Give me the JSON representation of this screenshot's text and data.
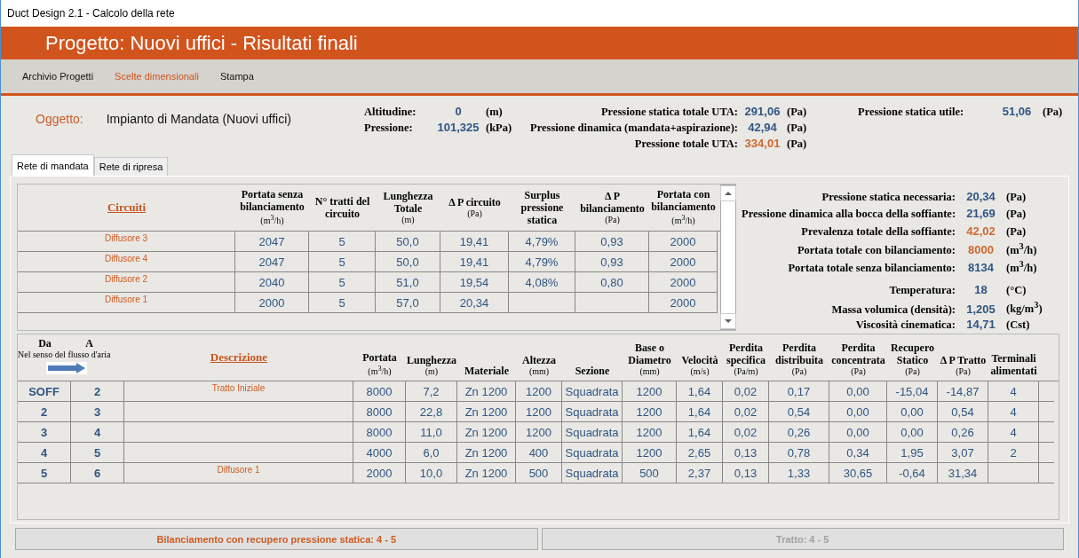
{
  "window": {
    "title": "Duct Design 2.1 - Calcolo della rete"
  },
  "banner": {
    "title": "Progetto: Nuovi uffici - Risultati finali"
  },
  "menu": [
    {
      "label": "Archivio Progetti",
      "selected": false
    },
    {
      "label": "Scelte dimensionali",
      "selected": true
    },
    {
      "label": "Stampa",
      "selected": false
    }
  ],
  "object": {
    "label": "Oggetto:",
    "value": "Impianto di Mandata (Nuovi uffici)"
  },
  "site": [
    {
      "label": "Altitudine:",
      "value": "0",
      "unit": "(m)"
    },
    {
      "label": "Pressione:",
      "value": "101,325",
      "unit": "(kPa)"
    }
  ],
  "uta": [
    {
      "label": "Pressione statica totale UTA:",
      "value": "291,06",
      "unit": "(Pa)",
      "emphasis": false
    },
    {
      "label": "Pressione dinamica (mandata+aspirazione):",
      "value": "42,94",
      "unit": "(Pa)",
      "emphasis": false
    },
    {
      "label": "Pressione totale UTA:",
      "value": "334,01",
      "unit": "(Pa)",
      "emphasis": true
    }
  ],
  "useful": {
    "label": "Pressione statica utile:",
    "value": "51,06",
    "unit": "(Pa)"
  },
  "tabs": [
    {
      "label": "Rete di mandata",
      "selected": true
    },
    {
      "label": "Rete di ripresa",
      "selected": false
    }
  ],
  "circuits": {
    "title": "Circuiti",
    "columns": [
      {
        "label": "Portata senza bilanciamento",
        "unit": "(m$^{3}$/h)"
      },
      {
        "label": "N° tratti del circuito"
      },
      {
        "label": "Lunghezza Totale",
        "unit": "(m)"
      },
      {
        "label": "Δ P circuito",
        "unit": "(Pa)"
      },
      {
        "label": "Surplus pressione statica"
      },
      {
        "label": "Δ P bilanciamento",
        "unit": "(Pa)"
      },
      {
        "label": "Portata con bilanciamento",
        "unit": "(m$^{3}$/h)"
      }
    ],
    "rows": [
      {
        "name": "Diffusore 3",
        "cells": [
          "2047",
          "5",
          "50,0",
          "19,41",
          "4,79%",
          "0,93",
          "2000"
        ]
      },
      {
        "name": "Diffusore 4",
        "cells": [
          "2047",
          "5",
          "50,0",
          "19,41",
          "4,79%",
          "0,93",
          "2000"
        ]
      },
      {
        "name": "Diffusore 2",
        "cells": [
          "2040",
          "5",
          "51,0",
          "19,54",
          "4,08%",
          "0,80",
          "2000"
        ]
      },
      {
        "name": "Diffusore 1",
        "cells": [
          "2000",
          "5",
          "57,0",
          "20,34",
          null,
          null,
          "2000"
        ]
      }
    ]
  },
  "stat_groups": [
    [
      {
        "label": "Pressione statica necessaria:",
        "value": "20,34",
        "unit": "(Pa)",
        "emphasis": false
      },
      {
        "label": "Pressione dinamica alla bocca della soffiante:",
        "value": "21,69",
        "unit": "(Pa)",
        "emphasis": false
      },
      {
        "label": "Prevalenza totale della soffiante:",
        "value": "42,02",
        "unit": "(Pa)",
        "emphasis": true
      },
      {
        "label": "Portata totale con bilanciamento:",
        "value": "8000",
        "unit": "(m$^{3}$/h)",
        "emphasis": true
      },
      {
        "label": "Portata totale senza bilanciamento:",
        "value": "8134",
        "unit": "(m$^{3}$/h)",
        "emphasis": false
      }
    ],
    [
      {
        "label": "Temperatura:",
        "value": "18",
        "unit": "(°C)",
        "emphasis": false
      },
      {
        "label": "Massa volumica (densità):",
        "value": "1,205",
        "unit": "(kg/m$^{3}$)",
        "emphasis": false
      },
      {
        "label": "Viscosità cinematica:",
        "value": "14,71",
        "unit": "(Cst)",
        "emphasis": false
      }
    ]
  ],
  "segments": {
    "from_label": "Da",
    "to_label": "A",
    "flow_note": "Nel senso del flusso d'aria",
    "description_label": "Descrizione",
    "columns": [
      {
        "label": "Portata",
        "unit": "(m$^{3}$/h)"
      },
      {
        "label": "Lunghezza",
        "unit": "(m)"
      },
      {
        "label": "Materiale"
      },
      {
        "label": "Altezza",
        "unit": "(mm)"
      },
      {
        "label": "Sezione"
      },
      {
        "label": "Base o Diametro",
        "unit": "(mm)"
      },
      {
        "label": "Velocità",
        "unit": "(m/s)"
      },
      {
        "label": "Perdita specifica",
        "unit": "(Pa/m)"
      },
      {
        "label": "Perdita distribuita",
        "unit": "(Pa)"
      },
      {
        "label": "Perdita concentrata",
        "unit": "(Pa)"
      },
      {
        "label": "Recupero Statico",
        "unit": "(Pa)"
      },
      {
        "label": "Δ P Tratto",
        "unit": "(Pa)"
      },
      {
        "label": "Terminali alimentati"
      }
    ],
    "rows": [
      {
        "from": "SOFF",
        "to": "2",
        "description": "Tratto Iniziale",
        "cells": [
          "8000",
          "7,2",
          "Zn 1200",
          "1200",
          "Squadrata",
          "1200",
          "1,64",
          "0,02",
          "0,17",
          "0,00",
          "-15,04",
          "-14,87",
          "4"
        ]
      },
      {
        "from": "2",
        "to": "3",
        "description": null,
        "cells": [
          "8000",
          "22,8",
          "Zn 1200",
          "1200",
          "Squadrata",
          "1200",
          "1,64",
          "0,02",
          "0,54",
          "0,00",
          "0,00",
          "0,54",
          "4"
        ]
      },
      {
        "from": "3",
        "to": "4",
        "description": null,
        "cells": [
          "8000",
          "11,0",
          "Zn 1200",
          "1200",
          "Squadrata",
          "1200",
          "1,64",
          "0,02",
          "0,26",
          "0,00",
          "0,00",
          "0,26",
          "4"
        ]
      },
      {
        "from": "4",
        "to": "5",
        "description": null,
        "cells": [
          "4000",
          "6,0",
          "Zn 1200",
          "400",
          "Squadrata",
          "1200",
          "2,65",
          "0,13",
          "0,78",
          "0,34",
          "1,95",
          "3,07",
          "2"
        ]
      },
      {
        "from": "5",
        "to": "6",
        "description": "Diffusore 1",
        "cells": [
          "2000",
          "10,0",
          "Zn 1200",
          "500",
          "Squadrata",
          "500",
          "2,37",
          "0,13",
          "1,33",
          "30,65",
          "-0,64",
          "31,34",
          null
        ]
      }
    ]
  },
  "footer": [
    {
      "label": "Bilanciamento con recupero pressione statica: 4 - 5",
      "disabled": false
    },
    {
      "label": "Tratto: 4 - 5",
      "disabled": true
    }
  ]
}
